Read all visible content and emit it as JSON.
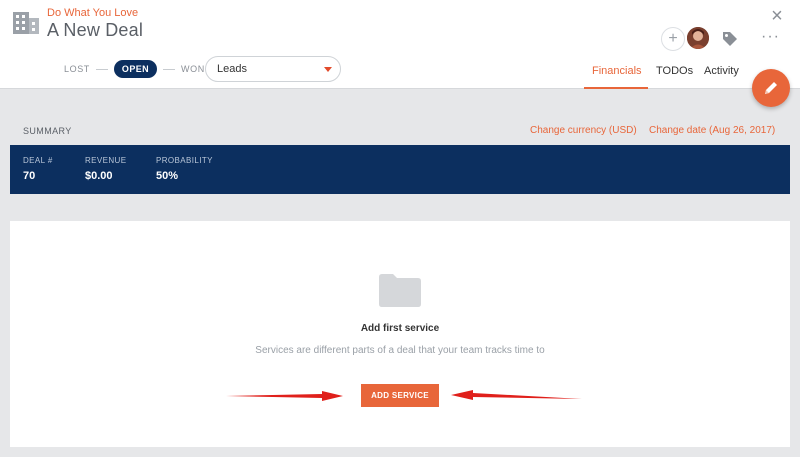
{
  "header": {
    "company_name": "Do What You Love",
    "deal_title": "A New Deal",
    "close_glyph": "×",
    "add_glyph": "+",
    "more_glyph": "···"
  },
  "status": {
    "lost_label": "LOST",
    "open_label": "OPEN",
    "won_label": "WON",
    "pipeline_value": "Leads"
  },
  "tabs": [
    {
      "label": "Financials",
      "active": true
    },
    {
      "label": "TODOs",
      "active": false
    },
    {
      "label": "Activity",
      "active": false
    }
  ],
  "summary": {
    "label": "SUMMARY",
    "change_currency": "Change currency (USD)",
    "change_date": "Change date (Aug 26, 2017)"
  },
  "stats": [
    {
      "key": "DEAL #",
      "value": "70"
    },
    {
      "key": "REVENUE",
      "value": "$0.00"
    },
    {
      "key": "PROBABILITY",
      "value": "50%"
    }
  ],
  "services": {
    "title": "Add first service",
    "description": "Services are different parts of a deal that your team tracks time to",
    "button_label": "ADD SERVICE"
  },
  "colors": {
    "accent": "#e8663a",
    "navy": "#0c2f5f",
    "arrow": "#e0201b"
  },
  "icons": {
    "company": "building-icon",
    "close": "close-icon",
    "add": "plus-icon",
    "tag": "tag-icon",
    "more": "more-icon",
    "edit": "pencil-icon",
    "empty": "folder-icon"
  }
}
